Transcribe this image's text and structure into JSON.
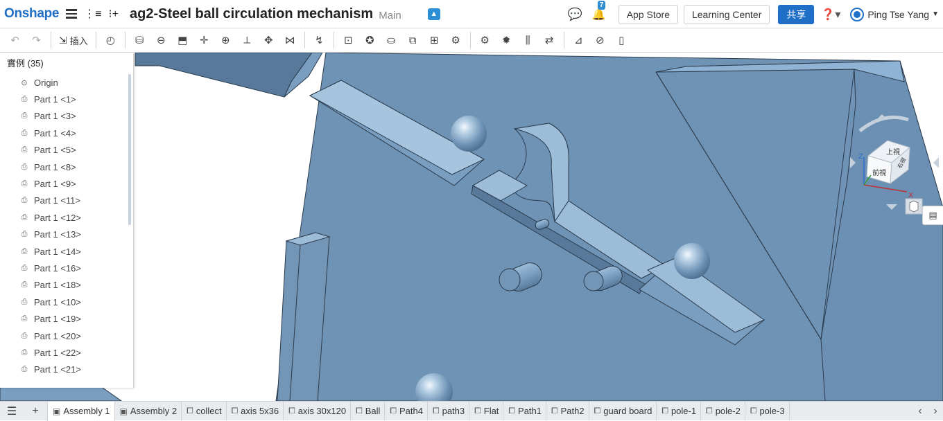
{
  "app": {
    "logo": "Onshape",
    "doc_title": "ag2-Steel ball circulation mechanism",
    "branch": "Main",
    "notification_count": "7",
    "app_store": "App Store",
    "learning_center": "Learning Center",
    "share": "共享",
    "user_name": "Ping Tse Yang"
  },
  "toolbar": {
    "insert_label": "插入",
    "icons": [
      "undo-icon",
      "redo-icon",
      "insert-icon",
      "history-icon",
      "fastened-mate-icon",
      "revolute-mate-icon",
      "slider-mate-icon",
      "planar-mate-icon",
      "cylindrical-mate-icon",
      "pin-slot-mate-icon",
      "ball-mate-icon",
      "parallel-mate-icon",
      "tangent-mate-icon",
      "mate-connector-icon",
      "group-icon",
      "replicate-icon",
      "pattern-icon",
      "snap-mode-icon",
      "explode-icon",
      "gear-relation-icon",
      "rack-pinion-icon",
      "screw-relation-icon",
      "linear-relation-icon",
      "measure-icon",
      "section-view-icon",
      "named-views-icon"
    ]
  },
  "panel": {
    "title": "實例 (35)",
    "items": [
      {
        "label": "Origin",
        "icon": "origin-icon"
      },
      {
        "label": "Part 1 <1>",
        "icon": "part-icon"
      },
      {
        "label": "Part 1 <3>",
        "icon": "part-icon"
      },
      {
        "label": "Part 1 <4>",
        "icon": "part-icon"
      },
      {
        "label": "Part 1 <5>",
        "icon": "part-icon"
      },
      {
        "label": "Part 1 <8>",
        "icon": "part-icon"
      },
      {
        "label": "Part 1 <9>",
        "icon": "part-icon"
      },
      {
        "label": "Part 1 <11>",
        "icon": "part-icon"
      },
      {
        "label": "Part 1 <12>",
        "icon": "part-icon"
      },
      {
        "label": "Part 1 <13>",
        "icon": "part-icon"
      },
      {
        "label": "Part 1 <14>",
        "icon": "part-icon"
      },
      {
        "label": "Part 1 <16>",
        "icon": "part-icon"
      },
      {
        "label": "Part 1 <18>",
        "icon": "part-icon"
      },
      {
        "label": "Part 1 <10>",
        "icon": "part-icon"
      },
      {
        "label": "Part 1 <19>",
        "icon": "part-icon"
      },
      {
        "label": "Part 1 <20>",
        "icon": "part-icon"
      },
      {
        "label": "Part 1 <22>",
        "icon": "part-icon"
      },
      {
        "label": "Part 1 <21>",
        "icon": "part-icon"
      }
    ]
  },
  "viewcube": {
    "top": "上視",
    "front": "前視",
    "right": "右視",
    "axis_x": "X",
    "axis_z": "Z"
  },
  "tabs": [
    {
      "label": "Assembly 1",
      "icon": "assembly-icon",
      "active": true
    },
    {
      "label": "Assembly 2",
      "icon": "assembly-icon",
      "active": false
    },
    {
      "label": "collect",
      "icon": "partstudio-icon",
      "active": false
    },
    {
      "label": "axis 5x36",
      "icon": "partstudio-icon",
      "active": false
    },
    {
      "label": "axis 30x120",
      "icon": "partstudio-icon",
      "active": false
    },
    {
      "label": "Ball",
      "icon": "partstudio-icon",
      "active": false
    },
    {
      "label": "Path4",
      "icon": "partstudio-icon",
      "active": false
    },
    {
      "label": "path3",
      "icon": "partstudio-icon",
      "active": false
    },
    {
      "label": "Flat",
      "icon": "partstudio-icon",
      "active": false
    },
    {
      "label": "Path1",
      "icon": "partstudio-icon",
      "active": false
    },
    {
      "label": "Path2",
      "icon": "partstudio-icon",
      "active": false
    },
    {
      "label": "guard board",
      "icon": "partstudio-icon",
      "active": false
    },
    {
      "label": "pole-1",
      "icon": "partstudio-icon",
      "active": false
    },
    {
      "label": "pole-2",
      "icon": "partstudio-icon",
      "active": false
    },
    {
      "label": "pole-3",
      "icon": "partstudio-icon",
      "active": false
    }
  ],
  "colors": {
    "brand": "#1f6fc7",
    "model_face": "#6f93b5",
    "model_dark": "#58799a",
    "model_light": "#8fb3d4"
  }
}
